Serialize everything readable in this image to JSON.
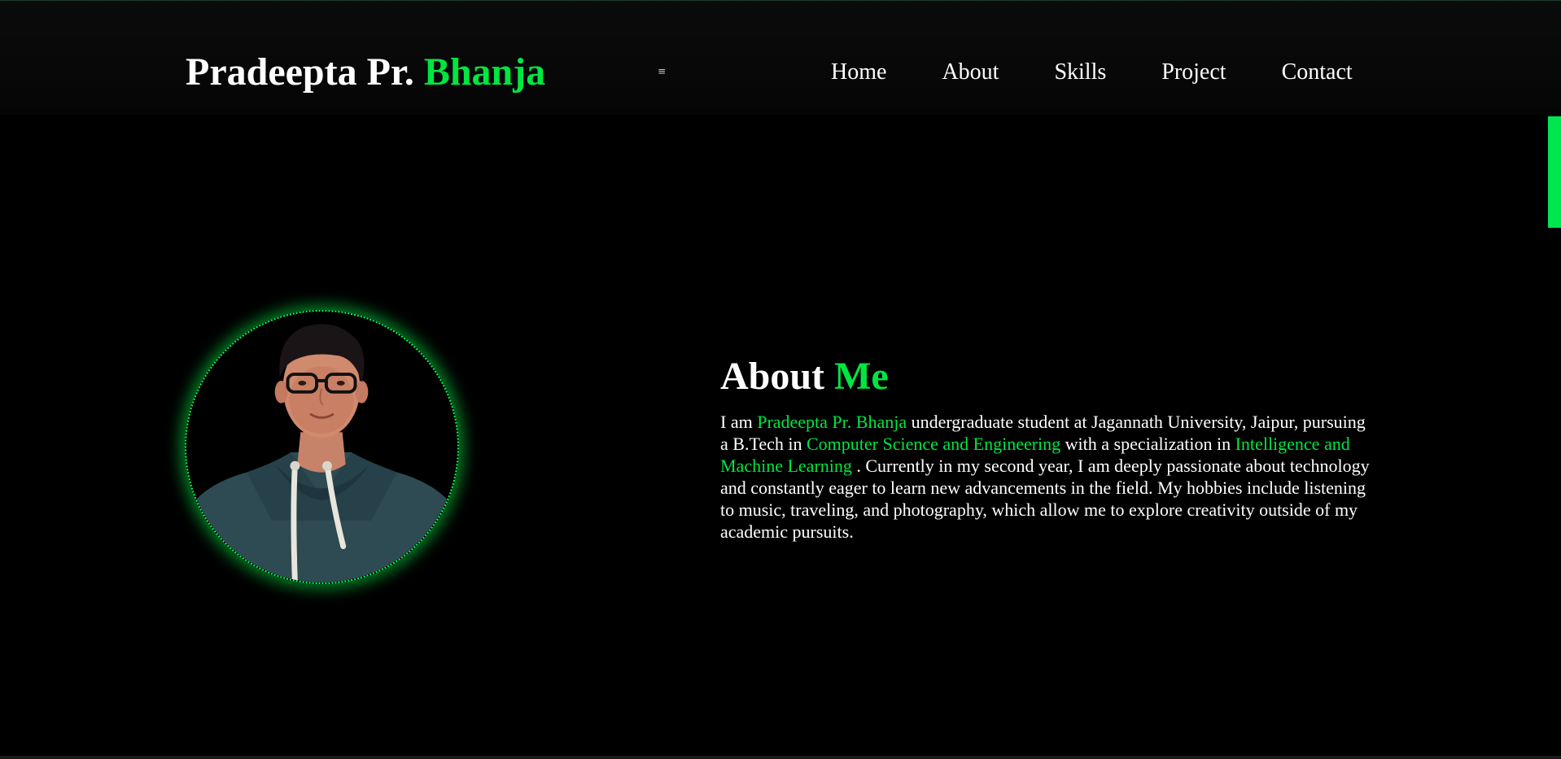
{
  "header": {
    "logo_first": "Pradeepta Pr.",
    "logo_accent": "Bhanja",
    "menu_icon": "hamburger-icon",
    "menu_glyph": "≡",
    "nav": [
      "Home",
      "About",
      "Skills",
      "Project",
      "Contact"
    ]
  },
  "about": {
    "title_first": "About",
    "title_accent": "Me",
    "paragraph": [
      {
        "text": "I am ",
        "highlight": false
      },
      {
        "text": "Pradeepta Pr. Bhanja",
        "highlight": true
      },
      {
        "text": " undergraduate student at Jagannath University, Jaipur, pursuing a B.Tech in ",
        "highlight": false
      },
      {
        "text": "Computer Science and Engineering",
        "highlight": true
      },
      {
        "text": " with a specialization in ",
        "highlight": false
      },
      {
        "text": "Intelligence and Machine Learning",
        "highlight": true
      },
      {
        "text": " . Currently in my second year, I am deeply passionate about technology and constantly eager to learn new advancements in the field. My hobbies include listening to music, traveling, and photography, which allow me to explore creativity outside of my academic pursuits.",
        "highlight": false
      }
    ]
  },
  "colors": {
    "accent": "#00e640",
    "background": "#000000",
    "text": "#ffffff"
  }
}
